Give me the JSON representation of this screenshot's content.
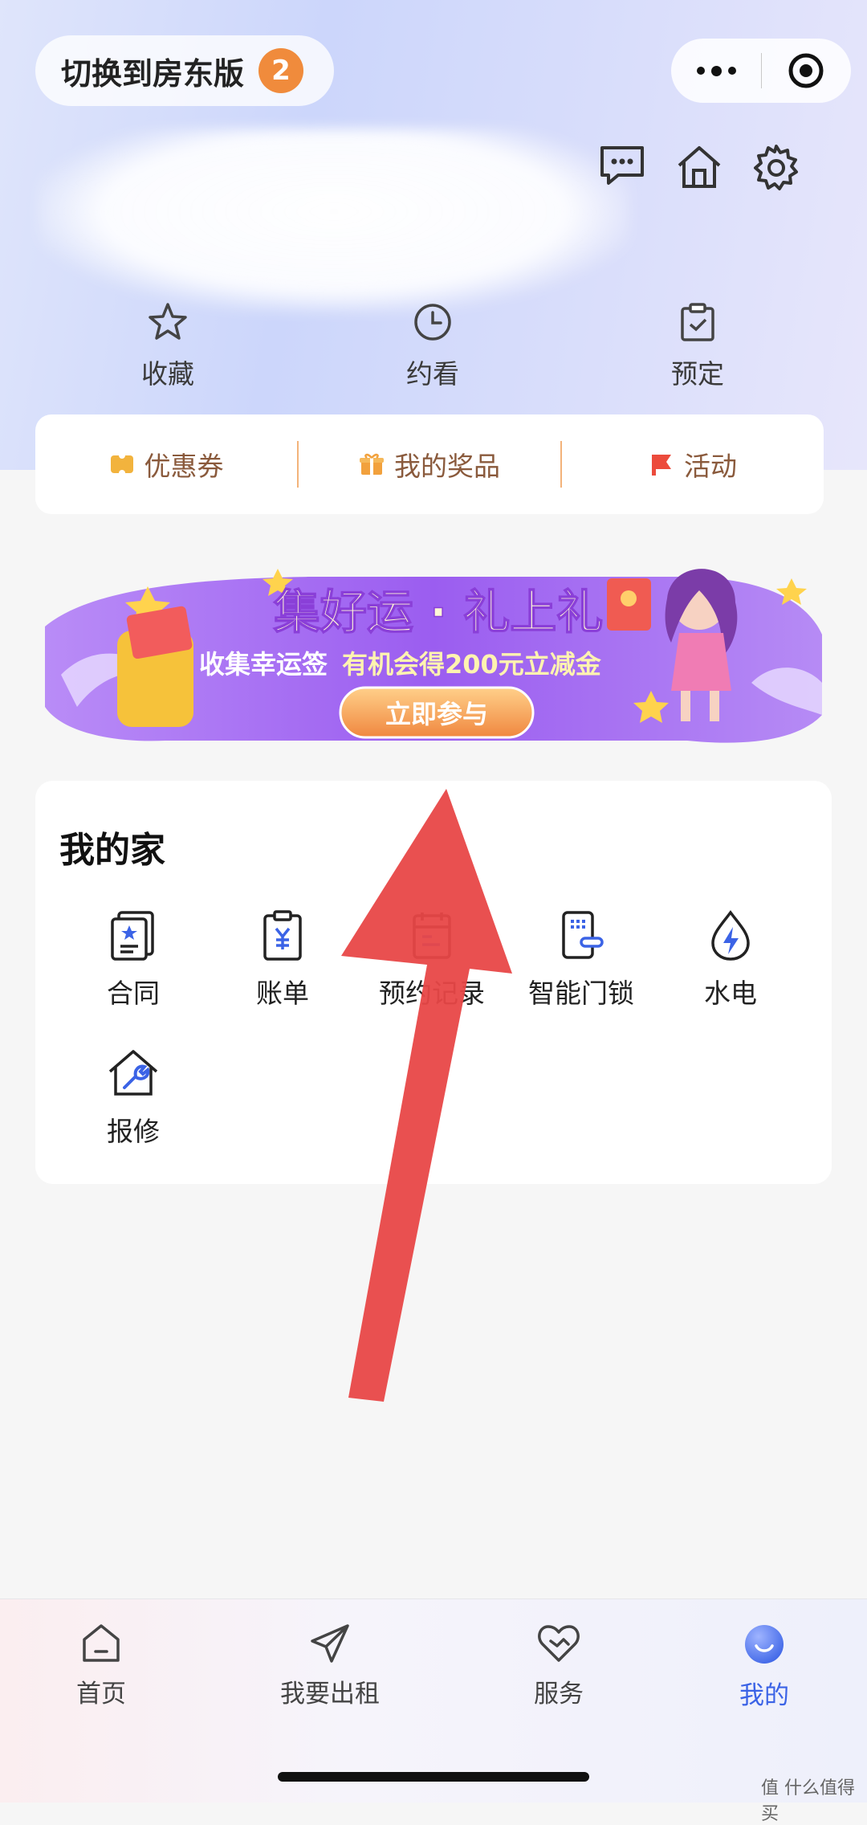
{
  "header": {
    "switch_label": "切换到房东版",
    "switch_badge": "2"
  },
  "quick_actions": [
    {
      "label": "收藏",
      "icon": "star-icon"
    },
    {
      "label": "约看",
      "icon": "clock-icon"
    },
    {
      "label": "预定",
      "icon": "clipboard-check-icon"
    }
  ],
  "benefits": [
    {
      "label": "优惠券",
      "icon": "coupon-icon"
    },
    {
      "label": "我的奖品",
      "icon": "gift-icon"
    },
    {
      "label": "活动",
      "icon": "flag-icon"
    }
  ],
  "banner": {
    "title": "集好运 · 礼上礼",
    "subtitle_left": "收集幸运签",
    "subtitle_right": "有机会得200元立减金",
    "cta": "立即参与",
    "colors": {
      "main": "#9b5df0",
      "cta": "#f0873f"
    }
  },
  "my_home": {
    "title": "我的家",
    "services": [
      {
        "label": "合同",
        "icon": "contract-icon"
      },
      {
        "label": "账单",
        "icon": "bill-icon"
      },
      {
        "label": "预约记录",
        "icon": "reservation-record-icon"
      },
      {
        "label": "智能门锁",
        "icon": "smart-lock-icon"
      },
      {
        "label": "水电",
        "icon": "water-electricity-icon"
      },
      {
        "label": "报修",
        "icon": "repair-icon"
      }
    ]
  },
  "tabbar": {
    "items": [
      {
        "label": "首页",
        "icon": "home-icon"
      },
      {
        "label": "我要出租",
        "icon": "paper-plane-icon"
      },
      {
        "label": "服务",
        "icon": "heart-handshake-icon"
      },
      {
        "label": "我的",
        "icon": "profile-icon",
        "active": true
      }
    ],
    "active_color": "#3b63e6"
  },
  "watermark": "值 什么值得买"
}
